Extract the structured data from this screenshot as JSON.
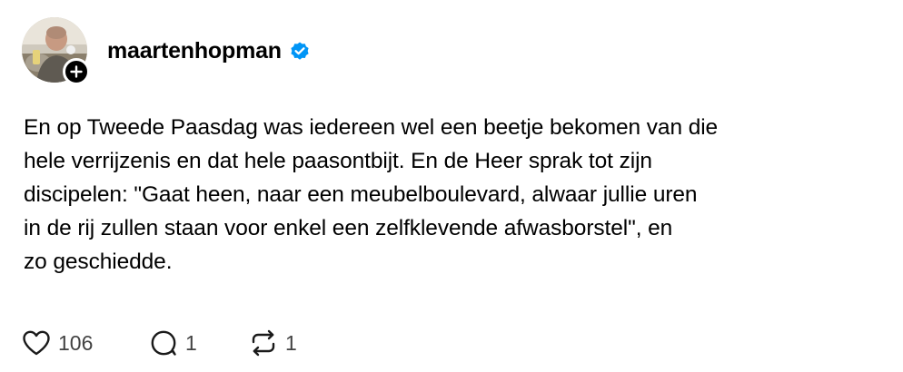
{
  "post": {
    "author": {
      "username": "maartenhopman",
      "verified": true,
      "avatar_icon": "avatar-photo",
      "follow_icon": "plus-icon"
    },
    "text_lines": [
      "En op Tweede Paasdag was iedereen wel een beetje bekomen van die",
      "hele verrijzenis en dat hele paasontbijt. En de Heer sprak tot zijn",
      "discipelen: \"Gaat heen, naar een meubelboulevard, alwaar jullie uren",
      "in de rij zullen staan voor enkel een zelfklevende afwasborstel\", en",
      "zo geschiedde."
    ],
    "actions": {
      "like": {
        "icon": "heart-icon",
        "count": "106"
      },
      "reply": {
        "icon": "comment-icon",
        "count": "1"
      },
      "repost": {
        "icon": "repost-icon",
        "count": "1"
      }
    }
  },
  "colors": {
    "verified_blue": "#0095f6",
    "text": "#000000",
    "muted": "#424242"
  }
}
